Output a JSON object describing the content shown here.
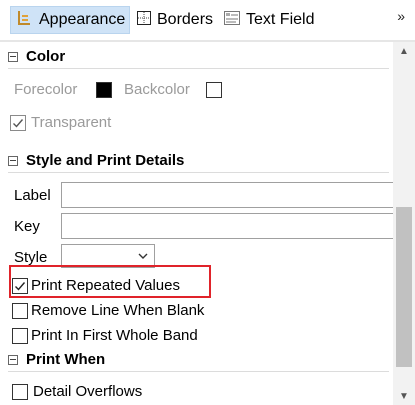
{
  "tabs": [
    {
      "label": "Appearance",
      "icon": "appearance-icon",
      "active": true
    },
    {
      "label": "Borders",
      "icon": "borders-icon",
      "active": false
    },
    {
      "label": "Text Field",
      "icon": "text-field-icon",
      "active": false
    }
  ],
  "overflow_label": "»",
  "color_section": {
    "title": "Color",
    "forecolor_label": "Forecolor",
    "forecolor_value": "#000000",
    "backcolor_label": "Backcolor",
    "backcolor_value": "#ffffff",
    "transparent_label": "Transparent",
    "transparent_checked": true
  },
  "style_section": {
    "title": "Style and Print Details",
    "label_field": {
      "label": "Label",
      "value": ""
    },
    "key_field": {
      "label": "Key",
      "value": ""
    },
    "style_field": {
      "label": "Style",
      "value": ""
    },
    "checkboxes": [
      {
        "label": "Print Repeated Values",
        "checked": true,
        "highlighted": true
      },
      {
        "label": "Remove Line When Blank",
        "checked": false
      },
      {
        "label": "Print In First Whole Band",
        "checked": false
      }
    ]
  },
  "print_when_section": {
    "title": "Print When",
    "checkboxes": [
      {
        "label": "Detail Overflows",
        "checked": false
      }
    ]
  },
  "colors": {
    "highlight": "#e0232a",
    "active_tab": "#cfe3f7"
  }
}
